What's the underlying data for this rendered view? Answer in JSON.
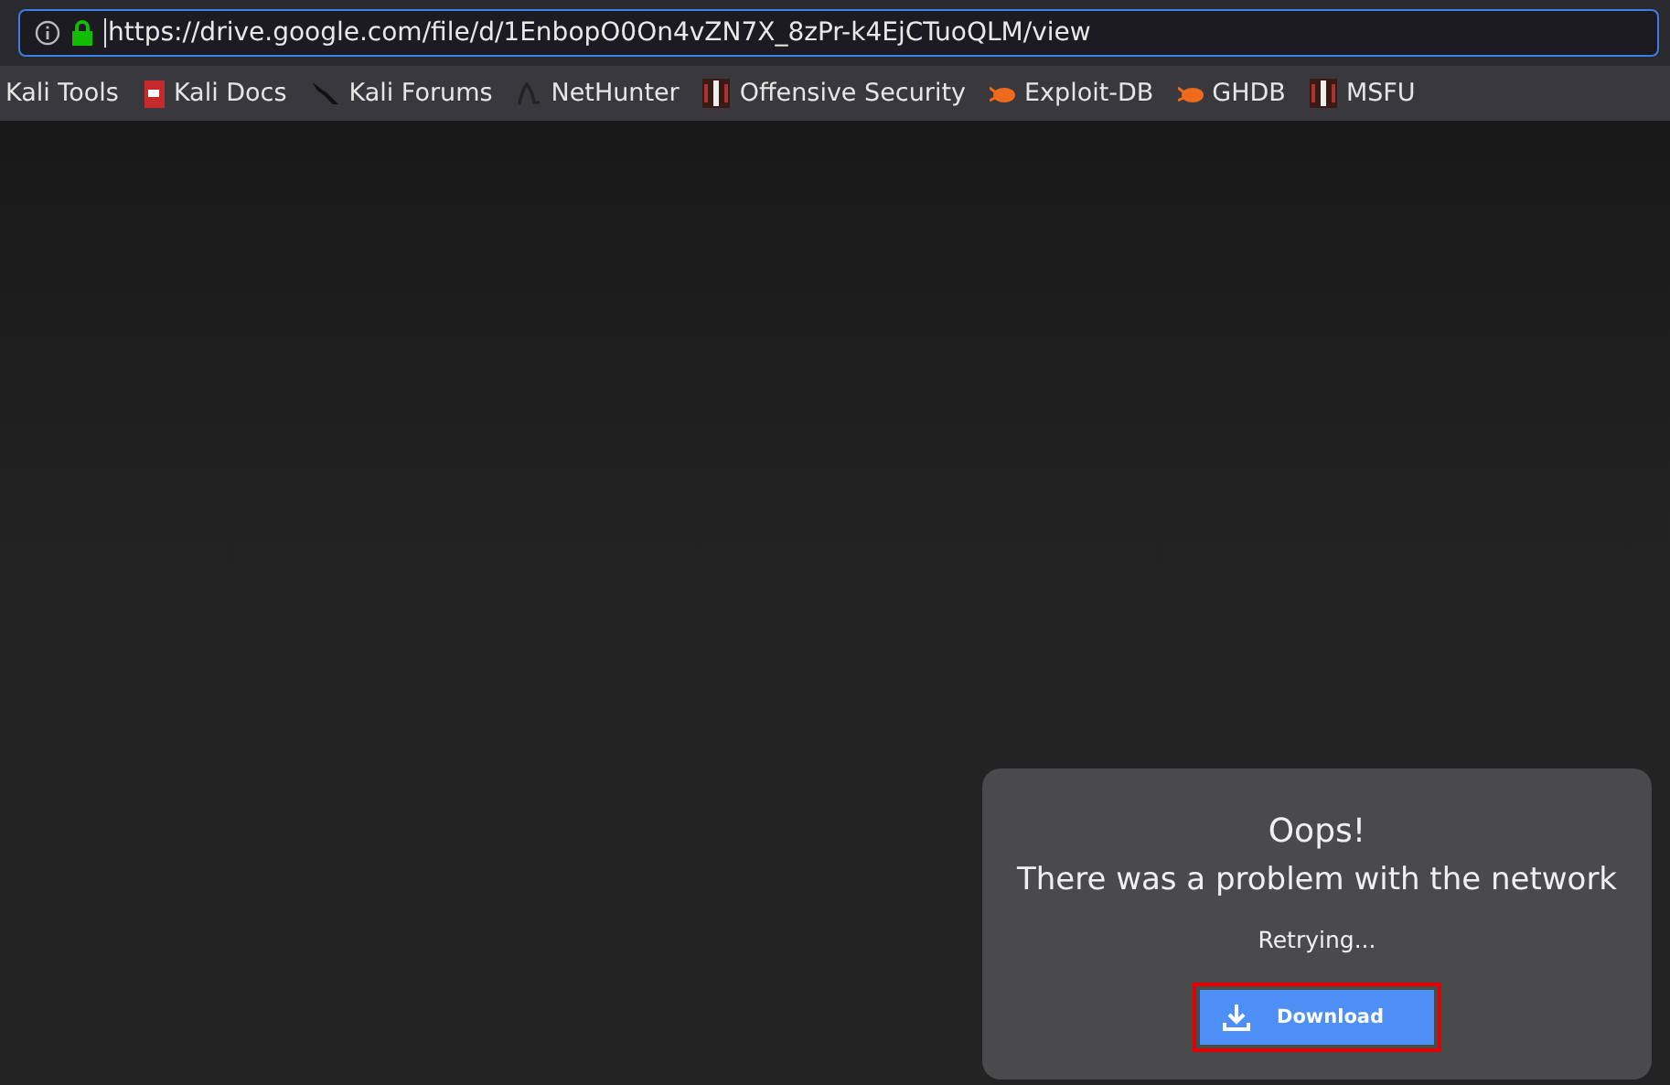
{
  "address_bar": {
    "url": "https://drive.google.com/file/d/1EnbopO0On4vZN7X_8zPr-k4EjCTuoQLM/view",
    "secure": true
  },
  "bookmarks": [
    {
      "label": "Kali Tools",
      "kind": "none"
    },
    {
      "label": "Kali Docs",
      "kind": "docs"
    },
    {
      "label": "Kali Forums",
      "kind": "forums"
    },
    {
      "label": "NetHunter",
      "kind": "nethunter"
    },
    {
      "label": "Offensive Security",
      "kind": "offsec"
    },
    {
      "label": "Exploit-DB",
      "kind": "bug"
    },
    {
      "label": "GHDB",
      "kind": "bug"
    },
    {
      "label": "MSFU",
      "kind": "offsec"
    }
  ],
  "error_card": {
    "title": "Oops!",
    "message": "There was a problem with the network",
    "status": "Retrying...",
    "button": {
      "label": "Download",
      "highlighted": true
    }
  }
}
